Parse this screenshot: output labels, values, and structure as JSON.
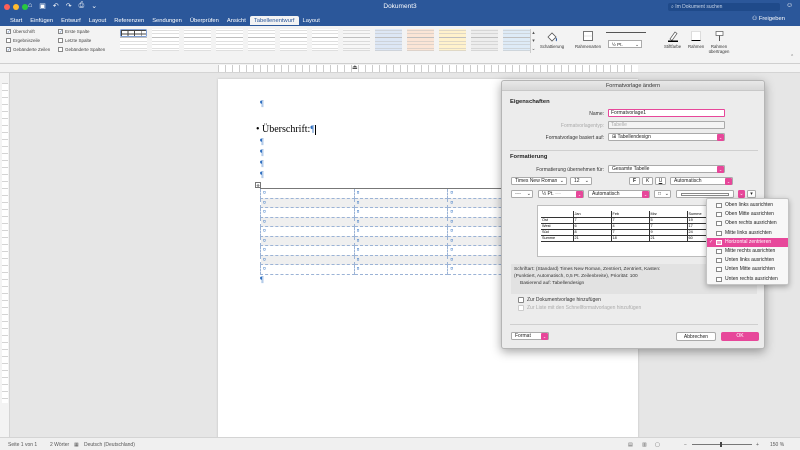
{
  "window": {
    "title": "Dokument3",
    "search_placeholder": "Im Dokument suchen",
    "share_label": "Freigeben",
    "share_icon": "person-plus-icon",
    "traffic_colors": [
      "#ff5f57",
      "#febc2e",
      "#28c840"
    ]
  },
  "quick_access": [
    "home-icon",
    "save-icon",
    "undo-icon",
    "redo-icon",
    "print-icon",
    "customize-icon"
  ],
  "tabs": [
    {
      "label": "Start",
      "active": false
    },
    {
      "label": "Einfügen",
      "active": false
    },
    {
      "label": "Entwurf",
      "active": false
    },
    {
      "label": "Layout",
      "active": false
    },
    {
      "label": "Referenzen",
      "active": false
    },
    {
      "label": "Sendungen",
      "active": false
    },
    {
      "label": "Überprüfen",
      "active": false
    },
    {
      "label": "Ansicht",
      "active": false
    },
    {
      "label": "Tabellenentwurf",
      "active": true
    },
    {
      "label": "Layout",
      "active": false
    }
  ],
  "ribbon": {
    "options": [
      {
        "label": "Überschrift",
        "checked": true
      },
      {
        "label": "Ergebniszeile",
        "checked": false
      },
      {
        "label": "Gebänderte Zeilen",
        "checked": true
      },
      {
        "label": "Erste Spalte",
        "checked": true
      },
      {
        "label": "Letzte Spalte",
        "checked": false
      },
      {
        "label": "Gebänderte Spalten",
        "checked": false
      }
    ],
    "shading_label": "Schattierung",
    "border_styles_label": "Rahmenarten",
    "pen_weight": "½ Pt.",
    "pen_color_label": "Stiftfarbe",
    "borders_label": "Rahmen",
    "border_painter_label": "Rahmen übertragen",
    "gallery_count": 14
  },
  "document": {
    "pilcrow": "¶",
    "heading_text": "Überschrift:",
    "table_cell_marker": "¤",
    "table_rows": 9,
    "table_cols": 3
  },
  "status": {
    "page": "Seite 1 von 1",
    "words": "2 Wörter",
    "language": "Deutsch (Deutschland)",
    "zoom": "150 %"
  },
  "dialog": {
    "title": "Formatvorlage ändern",
    "section_properties": "Eigenschaften",
    "name_label": "Name:",
    "name_value": "Formatvorlage1",
    "type_label": "Formatvorlagentyp:",
    "type_value": "Tabelle",
    "based_on_label": "Formatvorlage basiert auf:",
    "based_on_value": "Tabellendesign",
    "section_format": "Formatierung",
    "apply_to_label": "Formatierung übernehmen für:",
    "apply_to_value": "Gesamte Tabelle",
    "font_value": "Times New Roman",
    "size_value": "12",
    "bold": "F",
    "italic": "K",
    "underline": "U",
    "font_color_value": "Automatisch",
    "border_weight_value": "½ Pt.",
    "border_color_value": "Automatisch",
    "preview_table": [
      [
        "",
        "Jan",
        "Feb",
        "Mrz",
        "Summe"
      ],
      [
        "Ost",
        "7",
        "7",
        "5",
        "19"
      ],
      [
        "West",
        "6",
        "4",
        "7",
        "17"
      ],
      [
        "Süd",
        "8",
        "7",
        "9",
        "24"
      ],
      [
        "Summe",
        "21",
        "18",
        "21",
        "60"
      ]
    ],
    "description_lines": [
      "Schriftart: (Standard) Times New Roman, Zentriert, Zentriert, Kasten:",
      "(Punktiert, Automatisch, 0,5 Pt. Zeilenbreite), Priorität: 100",
      "Basierend auf: Tabellendesign"
    ],
    "add_to_template": "Zur Dokumentvorlage hinzufügen",
    "add_to_quick_styles": "Zur Liste mit den Schnellformatvorlagen hinzufügen",
    "format_button": "Format",
    "cancel_button": "Abbrechen",
    "ok_button": "OK",
    "accent_color": "#e7479a"
  },
  "alignment_menu": {
    "items": [
      {
        "label": "Oben links ausrichten",
        "selected": false
      },
      {
        "label": "Oben Mitte ausrichten",
        "selected": false
      },
      {
        "label": "Oben rechts ausrichten",
        "selected": false
      },
      {
        "label": "Mitte links ausrichten",
        "selected": false
      },
      {
        "label": "Horizontal zentrieren",
        "selected": true
      },
      {
        "label": "Mitte rechts ausrichten",
        "selected": false
      },
      {
        "label": "Unten links ausrichten",
        "selected": false
      },
      {
        "label": "Unten Mitte ausrichten",
        "selected": false
      },
      {
        "label": "Unten rechts ausrichten",
        "selected": false
      }
    ]
  }
}
